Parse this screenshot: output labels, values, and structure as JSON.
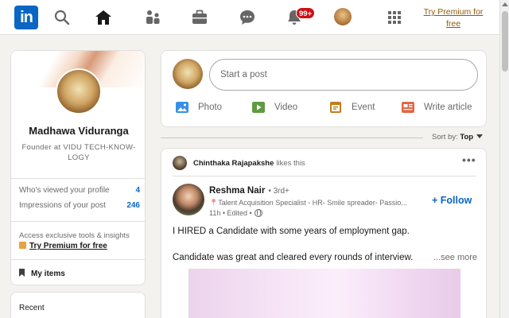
{
  "nav": {
    "logo_text": "in",
    "icons": [
      "search-icon",
      "home-icon",
      "my-network-icon",
      "jobs-icon",
      "messaging-icon",
      "notifications-icon",
      "me-avatar",
      "work-grid-icon"
    ],
    "notifications_badge": "99+",
    "premium_label": "Try Premium for free"
  },
  "profile": {
    "name": "Madhawa Viduranga",
    "headline": "Founder at VIDU TECH-KNOW-LOGY",
    "stats": [
      {
        "label": "Who's viewed your profile",
        "value": "4"
      },
      {
        "label": "Impressions of your post",
        "value": "246"
      }
    ],
    "promo_text": "Access exclusive tools & insights",
    "promo_link": "Try Premium for free",
    "my_items": "My items"
  },
  "recent": {
    "label": "Recent"
  },
  "share": {
    "placeholder": "Start a post",
    "actions": [
      {
        "label": "Photo",
        "icon": "photo-icon",
        "color": "#378fe9"
      },
      {
        "label": "Video",
        "icon": "video-icon",
        "color": "#5f9b41"
      },
      {
        "label": "Event",
        "icon": "event-icon",
        "color": "#c37d16"
      },
      {
        "label": "Write article",
        "icon": "article-icon",
        "color": "#e16745"
      }
    ]
  },
  "sort": {
    "label": "Sort by:",
    "value": "Top"
  },
  "post": {
    "liker": "Chinthaka Rajapakshe",
    "liker_action": "likes this",
    "author": "Reshma Nair",
    "degree": "• 3rd+",
    "author_headline": "📍Talent Acquisition Specialist - HR- Smile spreader- Passio...",
    "meta": "11h • Edited •",
    "follow_label": "+ Follow",
    "text_line1": "I HIRED a Candidate with some years of employment gap.",
    "text_line2": "Candidate was great and cleared every rounds of interview.",
    "see_more": "...see more"
  },
  "colors": {
    "brand": "#0a66c2",
    "premium": "#915907",
    "badge": "#cc1016"
  }
}
